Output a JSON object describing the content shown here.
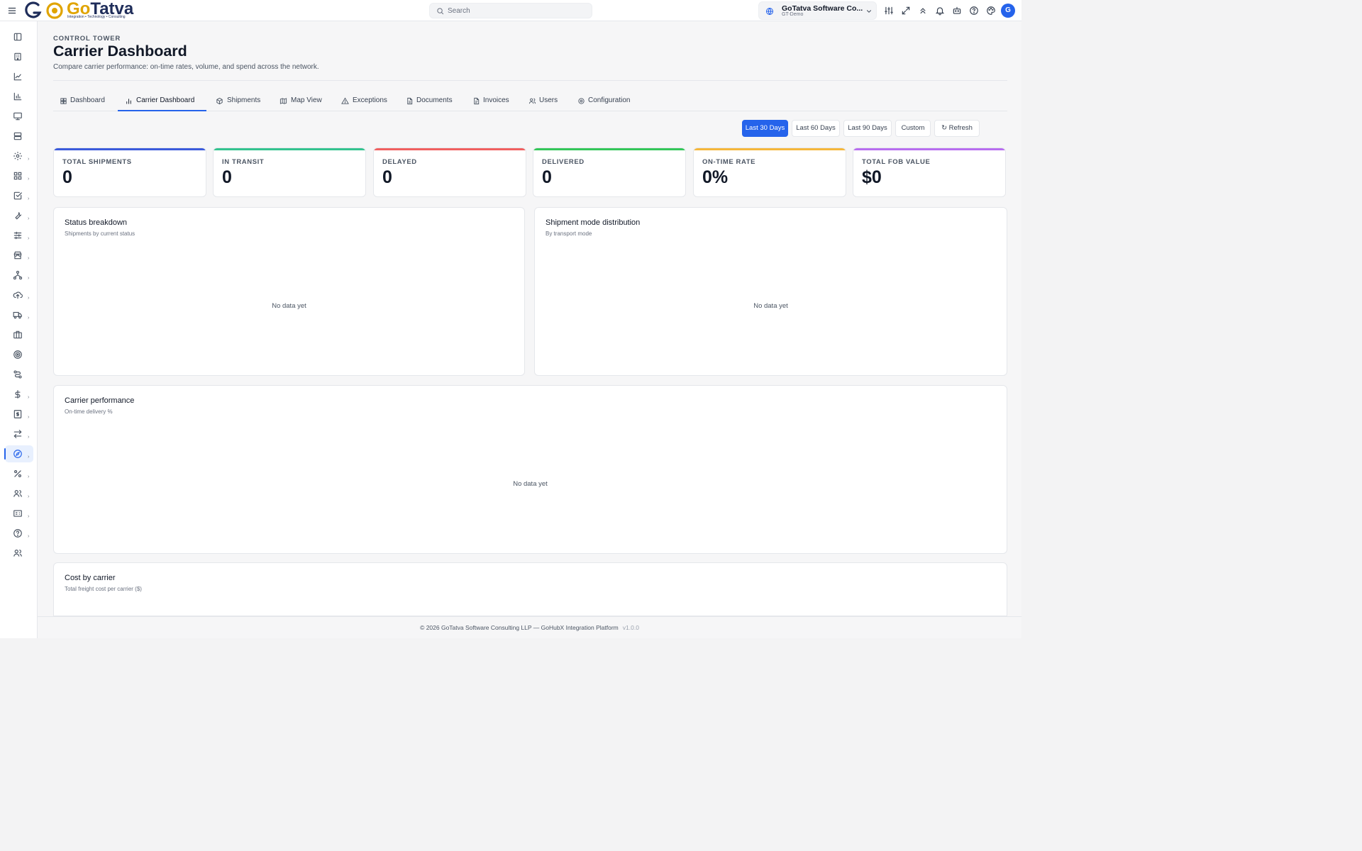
{
  "topbar": {
    "logo_text_a": "Go",
    "logo_text_b": "Tatva",
    "logo_tagline": "Integration • Technology • Consulting",
    "search_placeholder": "Search",
    "org_name": "GoTatva Software Co...",
    "org_env": "GT-Demo",
    "avatar_initial": "G",
    "icons": [
      "sliders-icon",
      "expand-icon",
      "chevrons-up-icon",
      "bell-icon",
      "bot-icon",
      "help-icon",
      "palette-icon"
    ]
  },
  "sidebar": {
    "items": [
      {
        "name": "sidebar-toggle",
        "icon": "panel-icon"
      },
      {
        "name": "companies",
        "icon": "building-icon"
      },
      {
        "name": "analytics",
        "icon": "line-chart-icon"
      },
      {
        "name": "reports",
        "icon": "bar-chart-icon"
      },
      {
        "name": "monitor",
        "icon": "monitor-icon"
      },
      {
        "name": "servers",
        "icon": "server-icon"
      },
      {
        "name": "settings",
        "icon": "gear-icon",
        "has_sub": true
      },
      {
        "name": "apps",
        "icon": "grid-icon",
        "has_sub": true
      },
      {
        "name": "tasks",
        "icon": "checkbox-icon",
        "has_sub": true
      },
      {
        "name": "tools",
        "icon": "wrench-icon",
        "has_sub": true
      },
      {
        "name": "adjustments",
        "icon": "sliders-icon",
        "has_sub": true
      },
      {
        "name": "store",
        "icon": "store-icon",
        "has_sub": true
      },
      {
        "name": "network",
        "icon": "network-icon",
        "has_sub": true
      },
      {
        "name": "upload",
        "icon": "cloud-upload-icon",
        "has_sub": true
      },
      {
        "name": "shipping",
        "icon": "truck-icon",
        "has_sub": true
      },
      {
        "name": "briefcase",
        "icon": "briefcase-icon"
      },
      {
        "name": "target",
        "icon": "target-icon"
      },
      {
        "name": "routes",
        "icon": "route-icon"
      },
      {
        "name": "finance",
        "icon": "dollar-icon",
        "has_sub": true
      },
      {
        "name": "billing",
        "icon": "receipt-icon",
        "has_sub": true
      },
      {
        "name": "transfers",
        "icon": "arrows-left-right-icon",
        "has_sub": true
      },
      {
        "name": "control-tower",
        "icon": "compass-icon",
        "has_sub": true,
        "active": true
      },
      {
        "name": "discounts",
        "icon": "percent-icon",
        "has_sub": true
      },
      {
        "name": "partners",
        "icon": "users-icon",
        "has_sub": true
      },
      {
        "name": "id-cards",
        "icon": "id-card-icon",
        "has_sub": true
      },
      {
        "name": "help",
        "icon": "help-circle-icon",
        "has_sub": true
      },
      {
        "name": "team",
        "icon": "team-icon"
      }
    ],
    "sub_arrow": "›"
  },
  "header": {
    "eyebrow": "CONTROL TOWER",
    "title": "Carrier Dashboard",
    "subtitle": "Compare carrier performance: on-time rates, volume, and spend across the network."
  },
  "tabs": [
    {
      "label": "Dashboard",
      "icon": "layout-grid-icon"
    },
    {
      "label": "Carrier Dashboard",
      "icon": "bar-chart-icon",
      "active": true
    },
    {
      "label": "Shipments",
      "icon": "package-icon"
    },
    {
      "label": "Map View",
      "icon": "map-icon"
    },
    {
      "label": "Exceptions",
      "icon": "alert-triangle-icon"
    },
    {
      "label": "Documents",
      "icon": "file-icon"
    },
    {
      "label": "Invoices",
      "icon": "file-text-icon"
    },
    {
      "label": "Users",
      "icon": "users-icon"
    },
    {
      "label": "Configuration",
      "icon": "gear-icon"
    }
  ],
  "date_ranges": [
    {
      "label": "Last 30 Days",
      "active": true
    },
    {
      "label": "Last 60 Days"
    },
    {
      "label": "Last 90 Days"
    },
    {
      "label": "Custom"
    },
    {
      "label": "↻ Refresh"
    }
  ],
  "kpis": [
    {
      "label": "TOTAL SHIPMENTS",
      "value": "0",
      "color": "#3b5bdb"
    },
    {
      "label": "IN TRANSIT",
      "value": "0",
      "color": "#34c38f"
    },
    {
      "label": "DELAYED",
      "value": "0",
      "color": "#f06060"
    },
    {
      "label": "DELIVERED",
      "value": "0",
      "color": "#34c759"
    },
    {
      "label": "ON-TIME RATE",
      "value": "0%",
      "color": "#f5b73b"
    },
    {
      "label": "TOTAL FOB VALUE",
      "value": "$0",
      "color": "#b86ef0"
    }
  ],
  "cards": {
    "status": {
      "title": "Status breakdown",
      "subtitle": "Shipments by current status",
      "empty": "No data yet"
    },
    "mode": {
      "title": "Shipment mode distribution",
      "subtitle": "By transport mode",
      "empty": "No data yet"
    },
    "carrier": {
      "title": "Carrier performance",
      "subtitle": "On-time delivery %",
      "empty": "No data yet"
    },
    "cost": {
      "title": "Cost by carrier",
      "subtitle": "Total freight cost per carrier ($)"
    }
  },
  "footer": {
    "text": "© 2026 GoTatva Software Consulting LLP — GoHubX Integration Platform",
    "version": "v1.0.0"
  }
}
